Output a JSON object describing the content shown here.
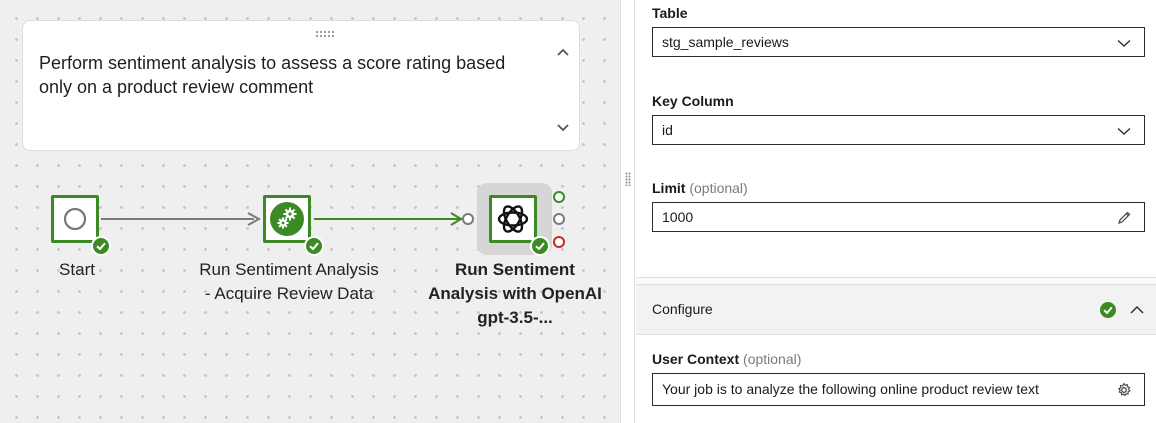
{
  "canvas": {
    "note": {
      "text": "Perform sentiment analysis to assess a score rating based only on a product review comment"
    },
    "nodes": [
      {
        "label": "Start",
        "icon": "start-circle-icon",
        "status": "success"
      },
      {
        "label": "Run Sentiment Analysis - Acquire Review Data",
        "icon": "gears-icon",
        "status": "success"
      },
      {
        "label": "Run Sentiment Analysis with OpenAI gpt-3.5-...",
        "icon": "openai-logo-icon",
        "status": "success",
        "selected": true
      }
    ],
    "output_ports": [
      "success",
      "default",
      "failure"
    ],
    "colors": {
      "accent": "#3b8a25",
      "edge": "#7a7a7a",
      "failure": "#c62828"
    }
  },
  "panel": {
    "table": {
      "label": "Table",
      "value": "stg_sample_reviews"
    },
    "key_column": {
      "label": "Key Column",
      "value": "id"
    },
    "limit": {
      "label": "Limit",
      "optional": "(optional)",
      "value": "1000"
    },
    "configure": {
      "title": "Configure",
      "status": "complete"
    },
    "user_context": {
      "label": "User Context",
      "optional": "(optional)",
      "value": "Your job is to analyze the following online product review text"
    }
  }
}
